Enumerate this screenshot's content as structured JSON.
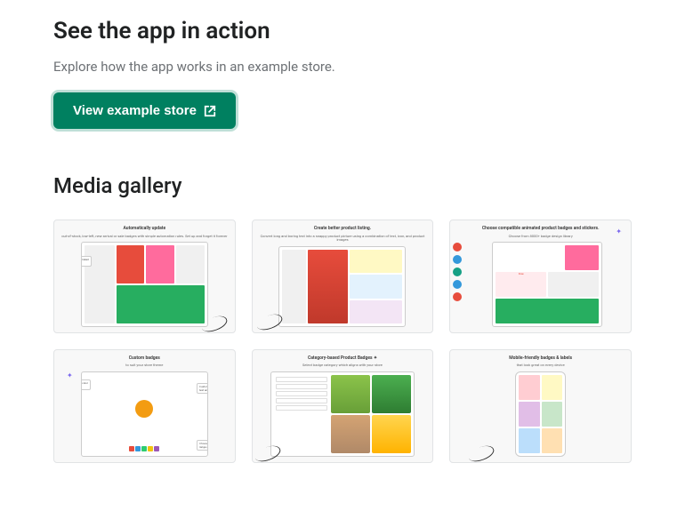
{
  "action_section": {
    "heading": "See the app in action",
    "description": "Explore how the app works in an example store.",
    "button_label": "View example store"
  },
  "media_section": {
    "heading": "Media gallery",
    "items": [
      {
        "title": "Automatically update",
        "subtitle": "out-of-stock, low-left, new arrival or sale badges with simple automation rules. Set up and forget it forever"
      },
      {
        "title": "Create better product listing.",
        "subtitle": "Convert long and boring text into a snappy product picture using a combination of text, icon, and product images"
      },
      {
        "title": "Choose compatible animated product badges and stickers.",
        "subtitle": "Choose from 8000+ badge design library"
      },
      {
        "title": "Custom badges",
        "subtitle": "to suit your store theme"
      },
      {
        "title": "Category-based Product Badges ✦",
        "subtitle": "Select badge category which aligns with your store"
      },
      {
        "title": "Mobile-friendly badges & labels",
        "subtitle": "that look great on every device"
      }
    ]
  }
}
